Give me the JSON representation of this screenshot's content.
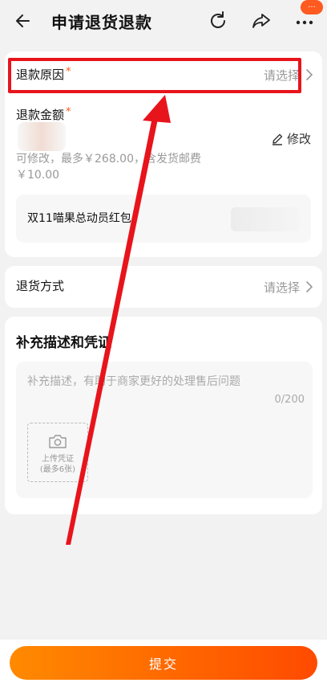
{
  "header": {
    "title": "申请退货退款",
    "notification_badge": "···"
  },
  "refund_reason": {
    "label": "退款原因",
    "required_mark": "*",
    "placeholder": "请选择"
  },
  "refund_amount": {
    "label": "退款金额",
    "required_mark": "*",
    "edit_label": "修改",
    "hint": "可修改，最多￥268.00，含发货邮费￥10.00"
  },
  "red_packet": {
    "label": "双11喵果总动员红包"
  },
  "return_method": {
    "label": "退货方式",
    "placeholder": "请选择"
  },
  "description": {
    "section_title": "补充描述和凭证",
    "placeholder": "补充描述，有助于商家更好的处理售后问题",
    "counter": "0/200",
    "upload_label": "上传凭证",
    "upload_limit": "(最多6张)"
  },
  "footer": {
    "submit_label": "提交"
  },
  "colors": {
    "accent": "#ff5a1f",
    "highlight": "#e8141c",
    "button_start": "#ff8a00",
    "button_end": "#ff4a00"
  },
  "icons": [
    "back-arrow-icon",
    "refresh-icon",
    "share-icon",
    "more-icon",
    "chevron-right-icon",
    "pencil-icon",
    "camera-icon"
  ]
}
